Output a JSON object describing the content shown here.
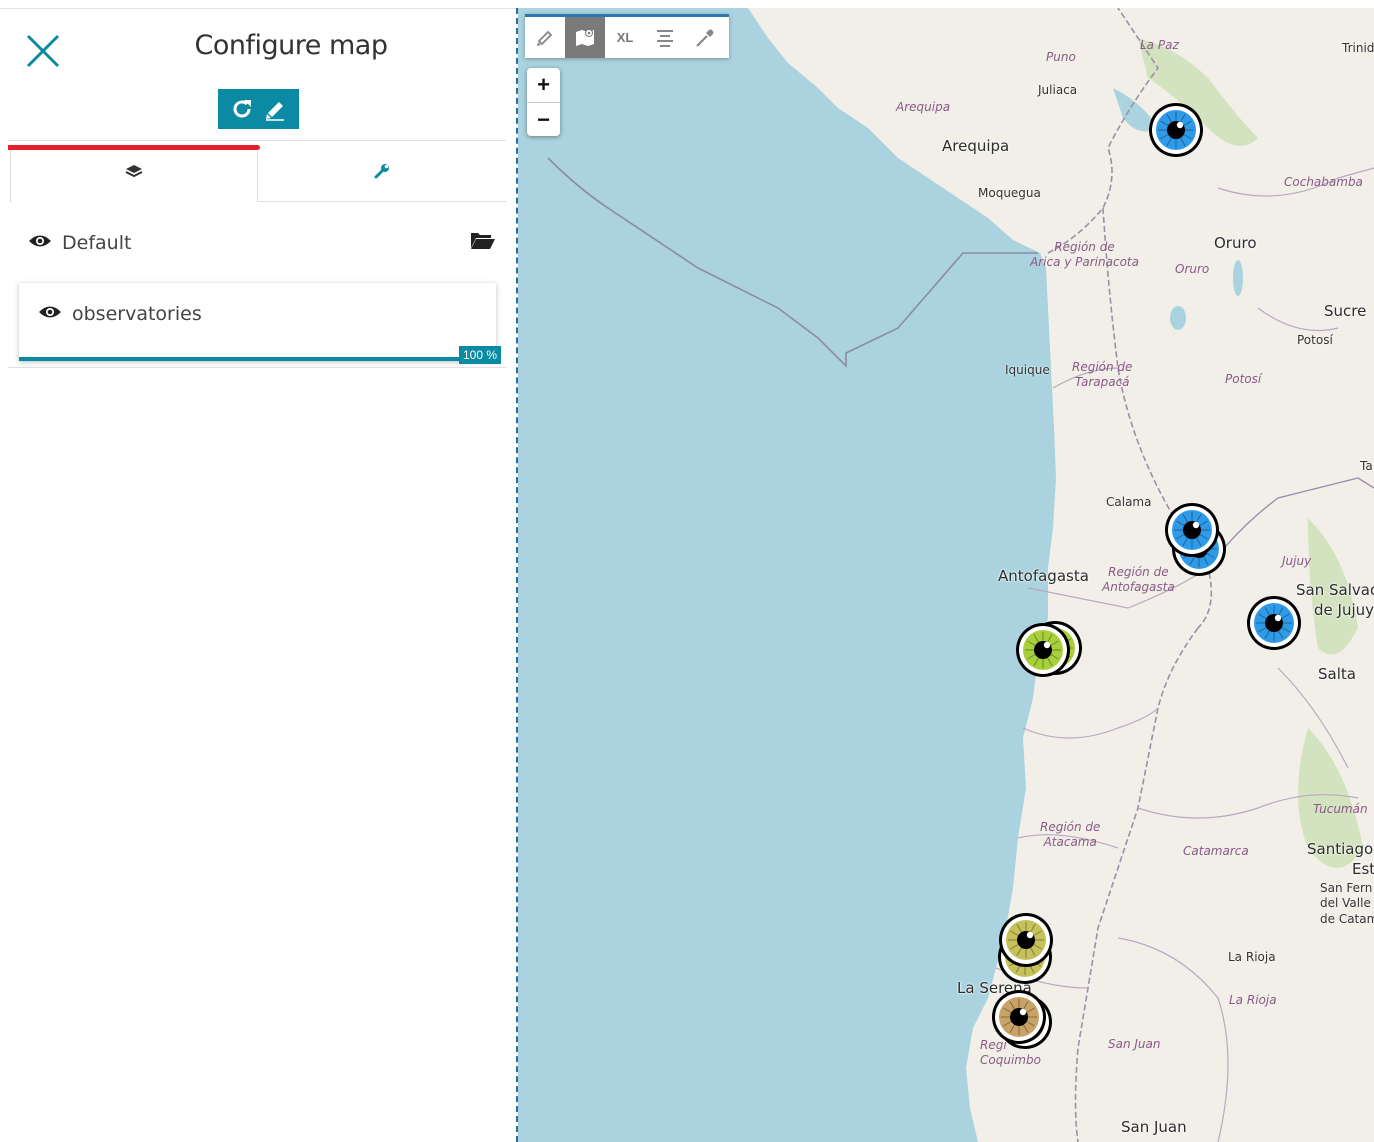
{
  "panel": {
    "title": "Configure map",
    "tabs": [
      {
        "name": "layers",
        "icon": "layers-icon",
        "active": true
      },
      {
        "name": "settings",
        "icon": "wrench-icon",
        "active": false
      }
    ],
    "layers": [
      {
        "name": "Default",
        "visible": true,
        "icon": "folder-open-icon"
      },
      {
        "name": "observatories",
        "visible": true,
        "progress_percent": 100,
        "progress_label": "100 %"
      }
    ]
  },
  "map": {
    "toolbar": [
      {
        "icon": "pencil-icon",
        "label": ""
      },
      {
        "icon": "map-marker-icon",
        "label": "",
        "active": true
      },
      {
        "icon": "xl-icon",
        "label": "XL"
      },
      {
        "icon": "align-icon",
        "label": ""
      },
      {
        "icon": "eyedropper-icon",
        "label": ""
      }
    ],
    "zoom_in": "+",
    "zoom_out": "−",
    "labels": {
      "la_paz": "La Paz",
      "trinid": "Trinid",
      "puno": "Puno",
      "juliaca": "Juliaca",
      "arequipa_region": "Arequipa",
      "arequipa": "Arequipa",
      "moquegua": "Moquegua",
      "cochabamba": "Cochabamba",
      "arica_region_1": "Región de",
      "arica_region_2": "Arica y Parinacota",
      "oruro": "Oruro",
      "oruro_region": "Oruro",
      "sucre": "Sucre",
      "potosi_town": "Potosí",
      "potosi_region": "Potosí",
      "iquique": "Iquique",
      "tarapaca_1": "Región de",
      "tarapaca_2": "Tarapacá",
      "ta": "Ta",
      "calama": "Calama",
      "antofagasta": "Antofagasta",
      "antofagasta_region_1": "Región de",
      "antofagasta_region_2": "Antofagasta",
      "jujuy": "Jujuy",
      "san_salvador_1": "San Salvad",
      "san_salvador_2": "de Jujuy",
      "salta": "Salta",
      "tucuman": "Tucumán",
      "atacama_1": "Región de",
      "atacama_2": "Atacama",
      "catamarca": "Catamarca",
      "santiago_1": "Santiago",
      "santiago_2": "Est",
      "sfvc_1": "San Fern",
      "sfvc_2": "del Valle",
      "sfvc_3": "de Catam",
      "la_serena": "La Serena",
      "la_rioja_town": "La Rioja",
      "la_rioja_region": "La Rioja",
      "coquimbo_1": "Regi",
      "coquimbo_2": "Coquimbo",
      "san_juan_region": "San Juan",
      "san_juan": "San Juan"
    },
    "colors": {
      "sea": "#aad3df",
      "land": "#f2efe9",
      "border": "#9e8ea8",
      "marker_blue": "#2f9ae8",
      "marker_green": "#a8cf3c",
      "marker_olive": "#c6c15a",
      "marker_tan": "#c8a267",
      "accent": "#0b8aa3",
      "tab_accent": "#e3202b"
    },
    "markers": [
      {
        "name": "marker-la-paz",
        "color": "blue"
      },
      {
        "name": "marker-calama-back",
        "color": "blue"
      },
      {
        "name": "marker-calama",
        "color": "blue"
      },
      {
        "name": "marker-jujuy",
        "color": "blue"
      },
      {
        "name": "marker-antofagasta-back",
        "color": "green"
      },
      {
        "name": "marker-antofagasta",
        "color": "green"
      },
      {
        "name": "marker-serena-back",
        "color": "olive"
      },
      {
        "name": "marker-serena",
        "color": "olive"
      },
      {
        "name": "marker-coquimbo-back",
        "color": "tan"
      },
      {
        "name": "marker-coquimbo",
        "color": "tan"
      }
    ]
  }
}
